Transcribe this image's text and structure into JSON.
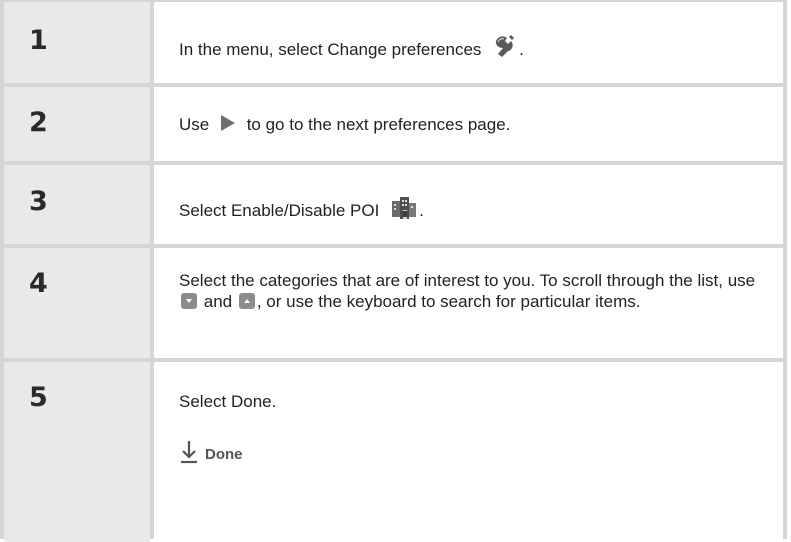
{
  "steps": [
    {
      "number": "1",
      "text_before": "In the menu, select Change preferences",
      "icon": "preferences-wrench-icon",
      "text_after": "."
    },
    {
      "number": "2",
      "text_before": "Use",
      "icon": "right-arrow-icon",
      "text_after": "to go to the next preferences page."
    },
    {
      "number": "3",
      "text_before": "Select Enable/Disable POI",
      "icon": "poi-buildings-icon",
      "text_after": "."
    },
    {
      "number": "4",
      "text_part1": "Select the categories that are of interest to you. To scroll through the list, use",
      "icon_down": "scroll-down-icon",
      "text_part2": "and",
      "icon_up": "scroll-up-icon",
      "text_part3": ", or use the keyboard to search for particular items."
    },
    {
      "number": "5",
      "text": "Select Done.",
      "done_icon": "down-arrow-icon",
      "done_label": "Done"
    }
  ],
  "colors": {
    "table_border": "#d6d6d6",
    "number_cell": "#e9e9e9",
    "body_cell": "#ffffff",
    "scroll_button": "#8c8c8c"
  }
}
